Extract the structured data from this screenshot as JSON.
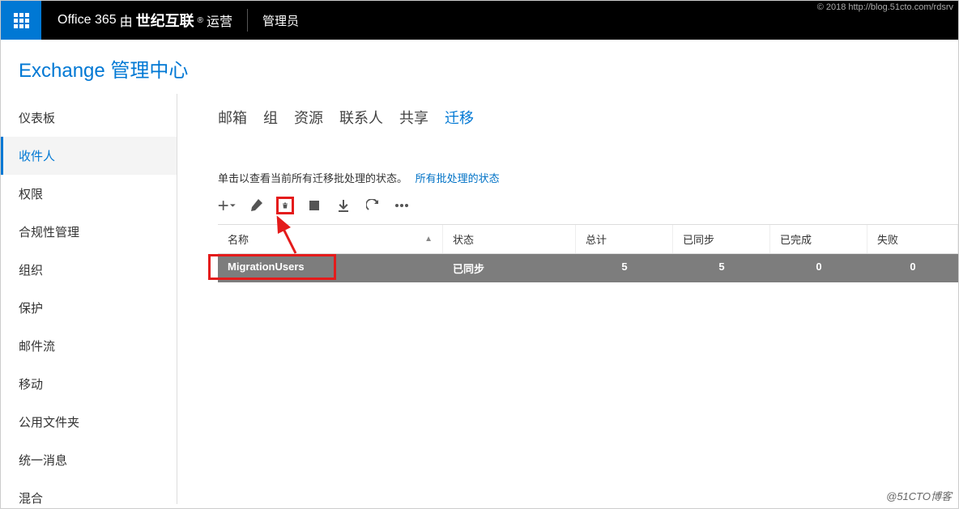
{
  "header": {
    "brand_prefix": "Office 365",
    "brand_by": "由",
    "brand_cn": "世纪互联",
    "brand_suffix": "运营",
    "admin_label": "管理员",
    "copyright": "© 2018 http://blog.51cto.com/rdsrv"
  },
  "page_title": "Exchange 管理中心",
  "sidebar": {
    "items": [
      {
        "label": "仪表板"
      },
      {
        "label": "收件人"
      },
      {
        "label": "权限"
      },
      {
        "label": "合规性管理"
      },
      {
        "label": "组织"
      },
      {
        "label": "保护"
      },
      {
        "label": "邮件流"
      },
      {
        "label": "移动"
      },
      {
        "label": "公用文件夹"
      },
      {
        "label": "统一消息"
      },
      {
        "label": "混合"
      }
    ],
    "active_index": 1
  },
  "tabs": {
    "items": [
      {
        "label": "邮箱"
      },
      {
        "label": "组"
      },
      {
        "label": "资源"
      },
      {
        "label": "联系人"
      },
      {
        "label": "共享"
      },
      {
        "label": "迁移"
      }
    ],
    "active_index": 5
  },
  "hint": {
    "text": "单击以查看当前所有迁移批处理的状态。",
    "link": "所有批处理的状态"
  },
  "table": {
    "columns": {
      "name": "名称",
      "status": "状态",
      "total": "总计",
      "synced": "已同步",
      "done": "已完成",
      "fail": "失败"
    },
    "rows": [
      {
        "name": "MigrationUsers",
        "status": "已同步",
        "total": "5",
        "synced": "5",
        "done": "0",
        "fail": "0"
      }
    ]
  },
  "watermark": "@51CTO博客"
}
